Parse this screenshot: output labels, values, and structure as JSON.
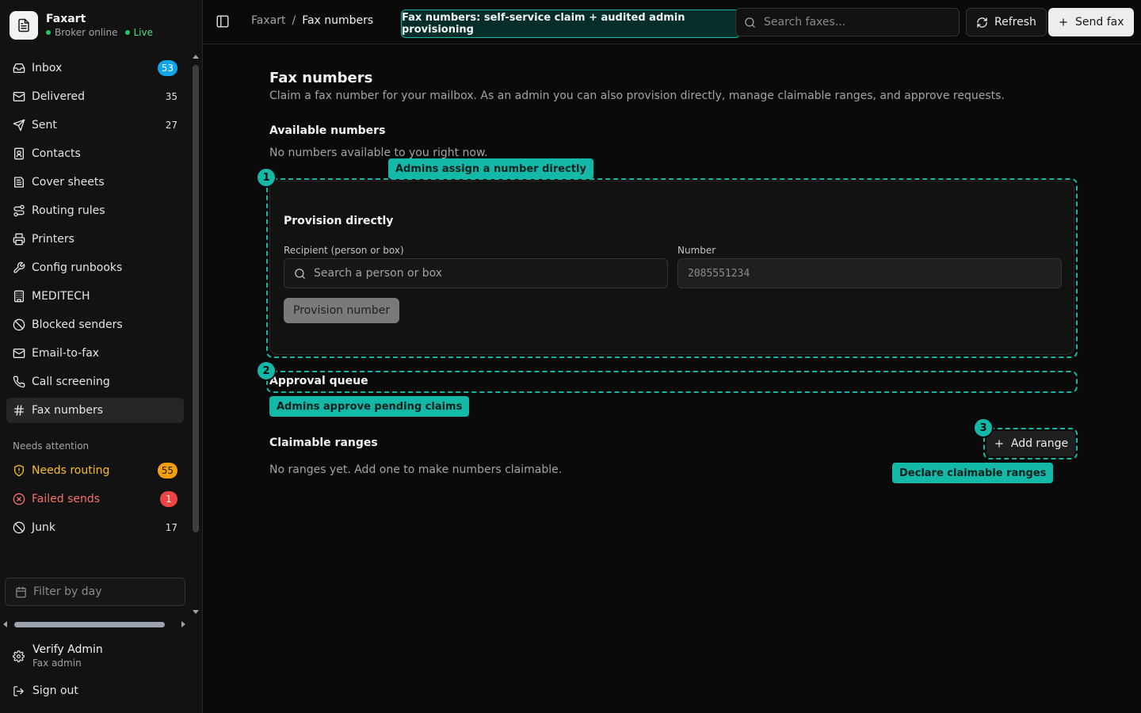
{
  "app": {
    "name": "Faxart",
    "status": "Broker online",
    "live": "Live"
  },
  "nav": [
    {
      "label": "Inbox",
      "badge": "53",
      "badge_style": "blue",
      "icon": "inbox-icon"
    },
    {
      "label": "Delivered",
      "badge": "35",
      "icon": "mail-icon"
    },
    {
      "label": "Sent",
      "badge": "27",
      "icon": "send-icon"
    },
    {
      "label": "Contacts",
      "icon": "contacts-icon"
    },
    {
      "label": "Cover sheets",
      "icon": "cover-sheet-icon"
    },
    {
      "label": "Routing rules",
      "icon": "route-icon"
    },
    {
      "label": "Printers",
      "icon": "printer-icon"
    },
    {
      "label": "Config runbooks",
      "icon": "wrench-icon"
    },
    {
      "label": "MEDITECH",
      "icon": "building-icon"
    },
    {
      "label": "Blocked senders",
      "icon": "ban-icon"
    },
    {
      "label": "Email-to-fax",
      "icon": "mail-icon"
    },
    {
      "label": "Call screening",
      "icon": "phone-icon"
    },
    {
      "label": "Fax numbers",
      "icon": "hash-icon",
      "active": true
    }
  ],
  "attention": {
    "label": "Needs attention",
    "items": [
      {
        "label": "Needs routing",
        "badge": "55",
        "badge_style": "amber",
        "tone": "warn",
        "icon": "shield-alert-icon"
      },
      {
        "label": "Failed sends",
        "badge": "1",
        "badge_style": "red",
        "tone": "err",
        "icon": "x-circle-icon"
      },
      {
        "label": "Junk",
        "badge": "17",
        "icon": "ban-icon"
      }
    ]
  },
  "filter_placeholder": "Filter by day",
  "user": {
    "name": "Verify Admin",
    "role": "Fax admin"
  },
  "signout": "Sign out",
  "header": {
    "breadcrumb_root": "Faxart",
    "breadcrumb_sep": "/",
    "breadcrumb_current": "Fax numbers",
    "banner": "Fax numbers: self-service claim + audited admin provisioning",
    "search_placeholder": "Search faxes...",
    "refresh": "Refresh",
    "send": "Send fax"
  },
  "page": {
    "title": "Fax numbers",
    "description": "Claim a fax number for your mailbox. As an admin you can also provision directly, manage claimable ranges, and approve requests.",
    "available_title": "Available numbers",
    "available_empty": "No numbers available to you right now.",
    "provision": {
      "title": "Provision directly",
      "recipient_label": "Recipient (person or box)",
      "recipient_placeholder": "Search a person or box",
      "number_label": "Number",
      "number_placeholder": "2085551234",
      "button": "Provision number"
    },
    "approval_title": "Approval queue",
    "ranges_title": "Claimable ranges",
    "ranges_empty": "No ranges yet. Add one to make numbers claimable.",
    "add_range": "Add range"
  },
  "annotations": [
    {
      "number": "1",
      "tag": "Admins assign a number directly"
    },
    {
      "number": "2",
      "tag": "Admins approve pending claims"
    },
    {
      "number": "3",
      "tag": "Declare claimable ranges"
    }
  ],
  "colors": {
    "accent": "#14b8a6",
    "badge_blue": "#0ea5e9",
    "badge_amber": "#f59e0b",
    "badge_red": "#ef4444"
  }
}
